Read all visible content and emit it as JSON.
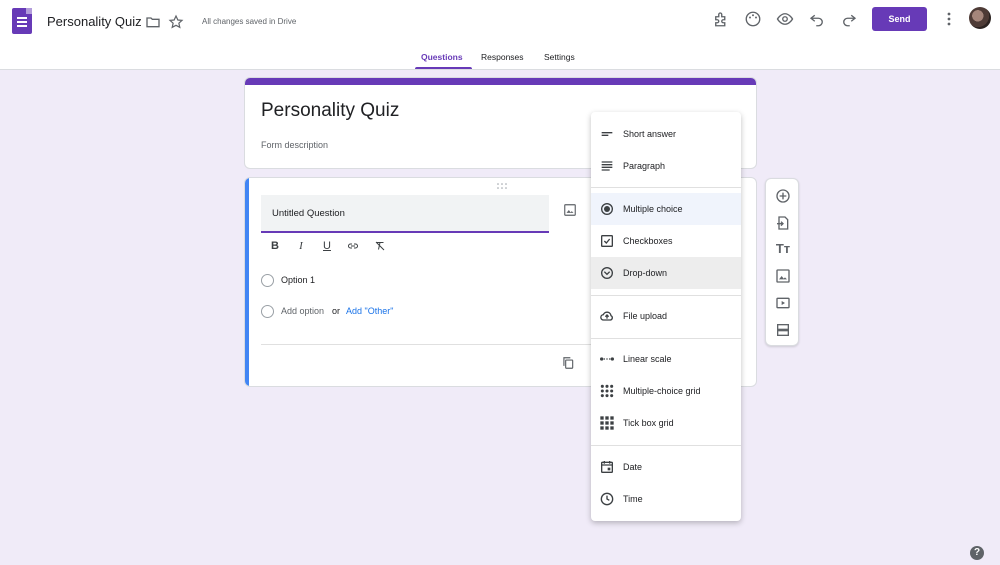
{
  "header": {
    "title": "Personality Quiz",
    "saved_status": "All changes saved in Drive",
    "send_label": "Send"
  },
  "tabs": [
    {
      "label": "Questions",
      "active": true
    },
    {
      "label": "Responses",
      "active": false
    },
    {
      "label": "Settings",
      "active": false
    }
  ],
  "form": {
    "title": "Personality Quiz",
    "description_placeholder": "Form description"
  },
  "question": {
    "title": "Untitled Question",
    "option1": "Option 1",
    "add_option": "Add option",
    "or": "or",
    "add_other": "Add \"Other\""
  },
  "question_type_menu": [
    {
      "label": "Short answer",
      "icon": "short-answer-icon"
    },
    {
      "label": "Paragraph",
      "icon": "paragraph-icon"
    },
    {
      "label": "Multiple choice",
      "icon": "radio-button-icon",
      "selected": true
    },
    {
      "label": "Checkboxes",
      "icon": "checkbox-icon"
    },
    {
      "label": "Drop-down",
      "icon": "dropdown-icon"
    },
    {
      "label": "File upload",
      "icon": "cloud-upload-icon"
    },
    {
      "label": "Linear scale",
      "icon": "linear-scale-icon"
    },
    {
      "label": "Multiple-choice grid",
      "icon": "grid-dots-icon"
    },
    {
      "label": "Tick box grid",
      "icon": "grid-squares-icon"
    },
    {
      "label": "Date",
      "icon": "calendar-icon"
    },
    {
      "label": "Time",
      "icon": "clock-icon"
    }
  ],
  "colors": {
    "brand": "#673ab7",
    "focus_accent": "#4285f4",
    "link": "#1a73e8",
    "background": "#f0ebf8"
  }
}
